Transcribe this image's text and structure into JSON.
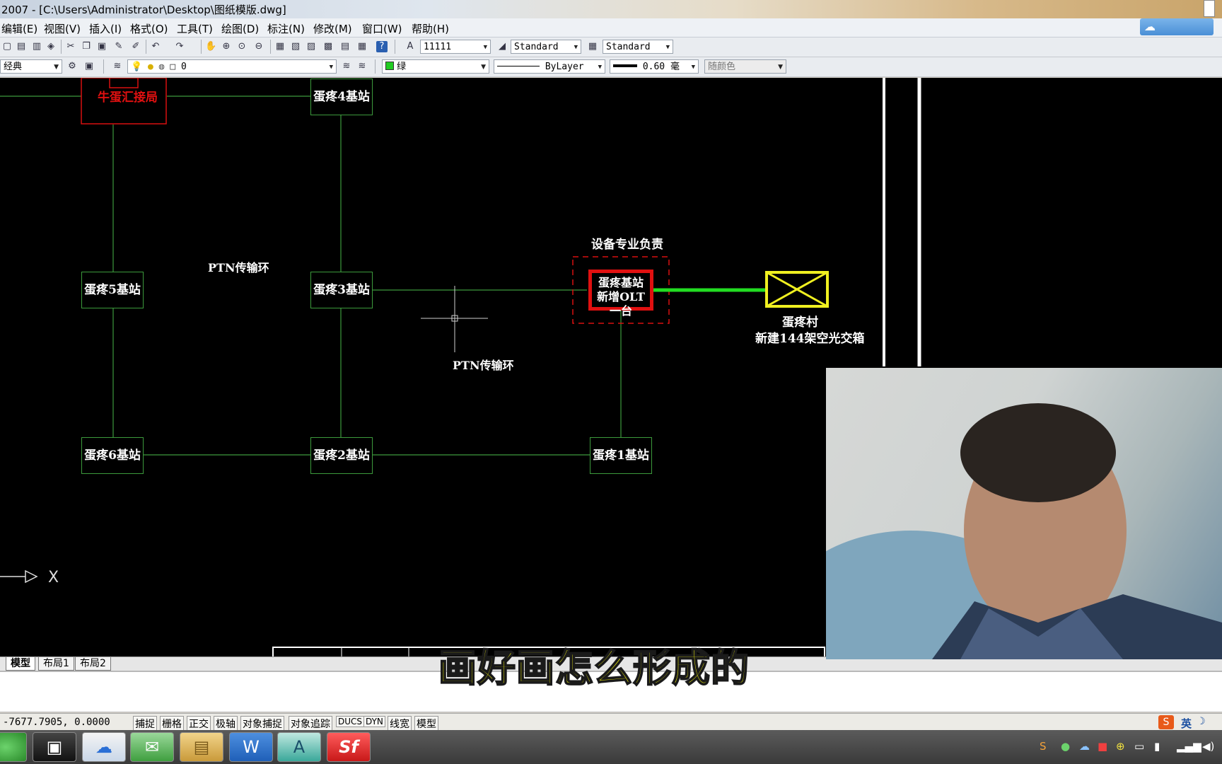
{
  "window": {
    "title": "2007 - [C:\\Users\\Administrator\\Desktop\\图纸模版.dwg]"
  },
  "menu": [
    "编辑(E)",
    "视图(V)",
    "插入(I)",
    "格式(O)",
    "工具(T)",
    "绘图(D)",
    "标注(N)",
    "修改(M)",
    "窗口(W)",
    "帮助(H)"
  ],
  "toolbar": {
    "text_style": "11111",
    "dim_style": "Standard",
    "table_style": "Standard",
    "workspace": "经典",
    "layer": "0",
    "color": "绿",
    "linetype": "ByLayer",
    "lineweight": "0.60 毫",
    "plot_style": "随颜色"
  },
  "drawing": {
    "nodes": {
      "hub": "牛蛋汇接局",
      "s4": "蛋疼4基站",
      "s5": "蛋疼5基站",
      "s3": "蛋疼3基站",
      "s6": "蛋疼6基站",
      "s2": "蛋疼2基站",
      "s1": "蛋疼1基站",
      "main_line1": "蛋疼基站",
      "main_line2": "新增OLT一台",
      "box_line1": "蛋疼村",
      "box_line2": "新建144架空光交箱"
    },
    "labels": {
      "ring_left": "PTN传输环",
      "ring_right": "PTN传输环",
      "equipment": "设备专业负责",
      "ucs_x": "X"
    }
  },
  "tabs": [
    "模型",
    "布局1",
    "布局2"
  ],
  "status": {
    "coords": "-7677.7905, 0.0000",
    "buttons": [
      "捕捉",
      "栅格",
      "正交",
      "极轴",
      "对象捕捉",
      "对象追踪",
      "DUCS",
      "DYN",
      "线宽",
      "模型"
    ],
    "ime": "英"
  },
  "subtitle": "画好画怎么形成的",
  "colors": {
    "accent_red": "#e01010",
    "accent_green": "#22dd22",
    "accent_yellow": "#f0f020",
    "line_green": "#3c9a3c"
  }
}
